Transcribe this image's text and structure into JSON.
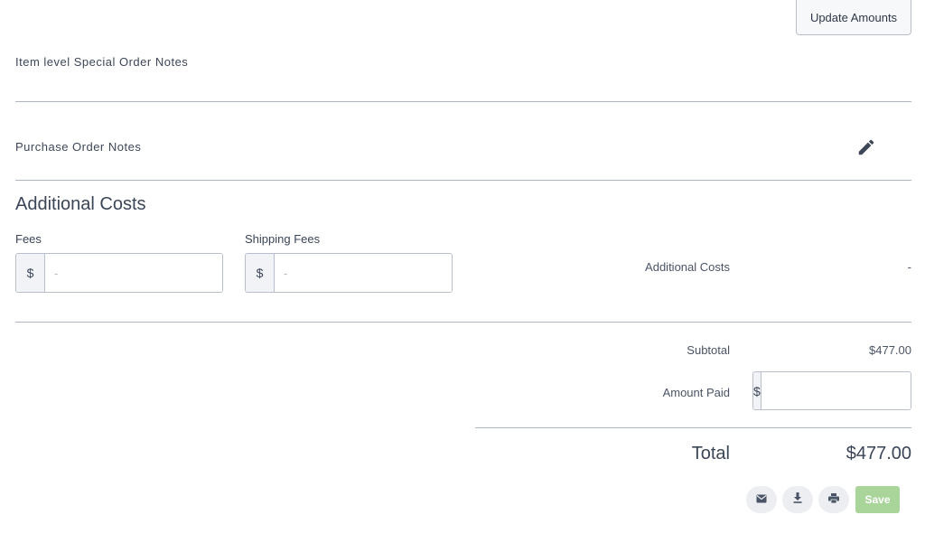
{
  "toolbar": {
    "update_amounts_label": "Update Amounts"
  },
  "notes": {
    "item_level_label": "Item level Special Order Notes",
    "purchase_order_label": "Purchase Order Notes"
  },
  "additional_costs": {
    "heading": "Additional Costs",
    "fees": {
      "label": "Fees",
      "currency": "$",
      "placeholder": "-"
    },
    "shipping_fees": {
      "label": "Shipping Fees",
      "currency": "$",
      "placeholder": "-"
    },
    "summary_label": "Additional Costs",
    "summary_value": "-"
  },
  "totals": {
    "subtotal_label": "Subtotal",
    "subtotal_value": "$477.00",
    "amount_paid_label": "Amount Paid",
    "amount_paid_currency": "$",
    "amount_paid_placeholder": "-",
    "total_label": "Total",
    "total_value": "$477.00"
  },
  "actions": {
    "icons": [
      "envelope-icon",
      "download-icon",
      "print-icon"
    ],
    "save_label": "Save"
  },
  "colors": {
    "accent_save": "#a9d49a",
    "text": "#3d4758",
    "divider": "#aeb5bf"
  }
}
